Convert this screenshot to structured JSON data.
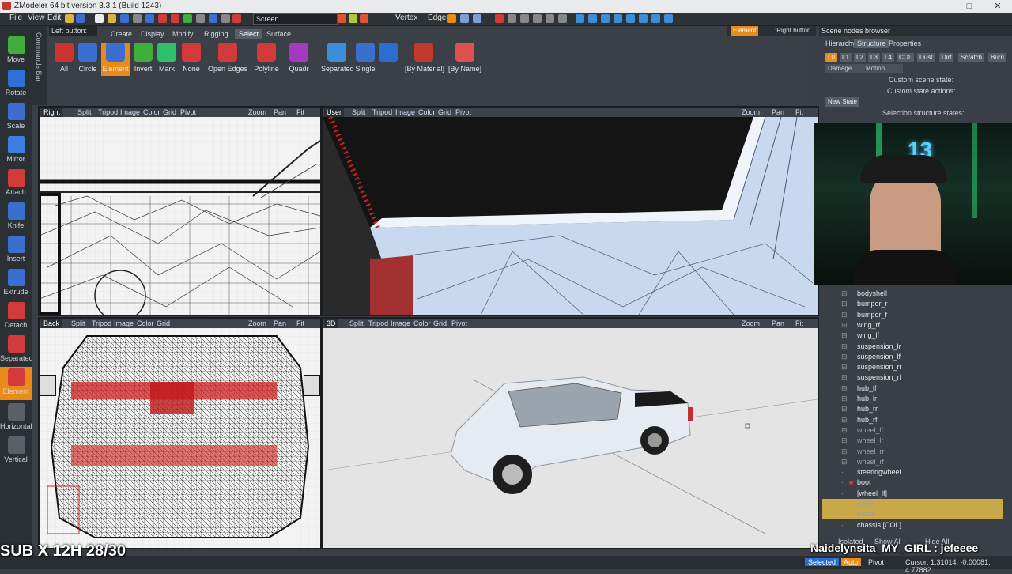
{
  "window": {
    "title": "ZModeler 64 bit version 3.3.1 (Build 1243)",
    "minimize": "─",
    "maximize": "□",
    "close": "✕"
  },
  "menubar": {
    "items": [
      "File",
      "View",
      "Edit"
    ],
    "screen_mode": "Screen",
    "vertex_label": "Vertex",
    "edge_label": "Edge"
  },
  "left_tools": [
    {
      "label": "Move",
      "color": "#3fae3a"
    },
    {
      "label": "Rotate",
      "color": "#2f6fd6"
    },
    {
      "label": "Scale",
      "color": "#3a6fd0"
    },
    {
      "label": "Mirror",
      "color": "#3d7de0"
    },
    {
      "label": "Attach",
      "color": "#d33a3a"
    },
    {
      "label": "Knife",
      "color": "#3a6fd0"
    },
    {
      "label": "Insert",
      "color": "#3a6fd0"
    },
    {
      "label": "Extrude",
      "color": "#3a6fd0"
    },
    {
      "label": "Detach",
      "color": "#d33a3a"
    },
    {
      "label": "Separated",
      "color": "#d33a3a"
    },
    {
      "label": "Element",
      "color": "#d33a3a"
    },
    {
      "label": "Horizontal",
      "color": "#5a6068"
    },
    {
      "label": "Vertical",
      "color": "#5a6068"
    }
  ],
  "commands_bar_label": "Commands Bar",
  "ribbon": {
    "left_button": "Left button:",
    "tabs": [
      "Create",
      "Display",
      "Modify",
      "Rigging",
      "Select",
      "Surface"
    ],
    "active_tab": "Select",
    "buttons": [
      "All",
      "Circle",
      "Element",
      "Invert",
      "Mark",
      "None",
      "Open Edges",
      "Polyline",
      "Quadr",
      "Separated",
      "Single",
      "",
      "[By Material]",
      "[By Name]"
    ],
    "active_button": "Element",
    "hint_element": "Element",
    "hint_right": ":Right button"
  },
  "viewport_menu": [
    "Split",
    "Tripod",
    "Image",
    "Color",
    "Grid",
    "Pivot"
  ],
  "viewport_tools": [
    "Zoom",
    "Pan",
    "Fit"
  ],
  "viewports": {
    "top_left": {
      "name": "Right"
    },
    "top_right": {
      "name": "User"
    },
    "bottom_left": {
      "name": "Back"
    },
    "bottom_right": {
      "name": "3D"
    }
  },
  "scene_browser": {
    "title": "Scene nodes browser",
    "tabs": [
      "Hierarchy",
      "Structure",
      "Properties"
    ],
    "active_tab": "Structure",
    "chips": [
      "L0",
      "L1",
      "L2",
      "L3",
      "L4",
      "COL",
      "Dust",
      "Dirt",
      "Scratch",
      "Burn"
    ],
    "damage": "Damage",
    "motion": "Motion",
    "custom_state": "Custom scene state:",
    "custom_actions": "Custom state actions:",
    "new_state": "New State",
    "selection_states": "Selection structure states:",
    "nodes": [
      "bodyshell",
      "bumper_r",
      "bumper_f",
      "wing_rf",
      "wing_lf",
      "suspension_lr",
      "suspension_lf",
      "suspension_rr",
      "suspension_rf",
      "hub_lf",
      "hub_lr",
      "hub_rr",
      "hub_rf",
      "wheel_lf",
      "wheel_lr",
      "wheel_rr",
      "wheel_rf",
      "steeringwheel",
      "boot",
      "[wheel_lf]",
      "placa",
      "placa",
      "chassis [COL]"
    ],
    "footer": [
      "Isolated",
      "Show All",
      "Hide All"
    ]
  },
  "webcam": {
    "sign": "13"
  },
  "statusbar": {
    "selected": "Selected",
    "auto": "Auto",
    "pivot": "Pivot",
    "cursor": "Cursor: 1.31014, -0.00081, 4.77882"
  },
  "overlay": {
    "sub_counter": "SUB X 12H 28/30",
    "chat_user": "Naidelynsita_MY_GIRL : jefeeee"
  }
}
